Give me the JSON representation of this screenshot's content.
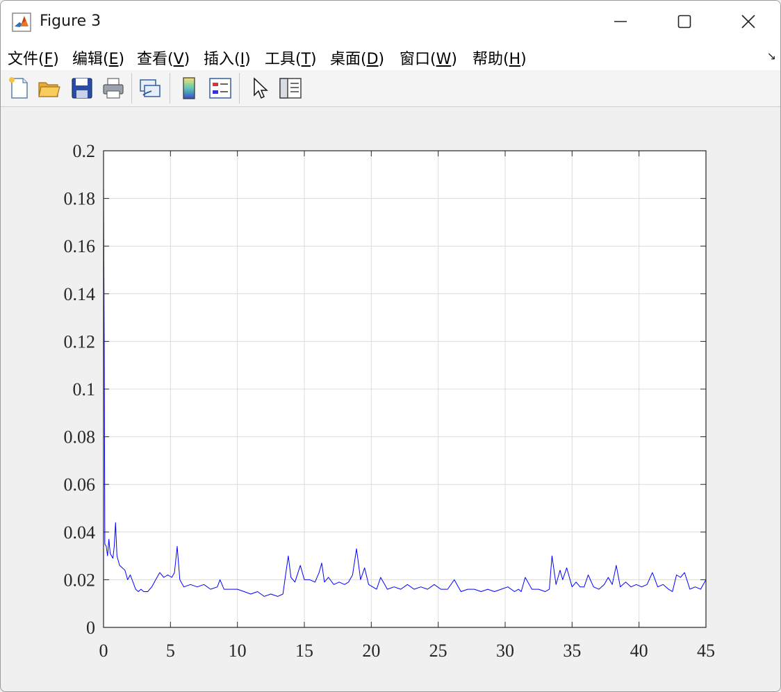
{
  "window": {
    "title": "Figure 3"
  },
  "menu": {
    "items": [
      {
        "pre": "文件(",
        "key": "F",
        "post": ")"
      },
      {
        "pre": "编辑(",
        "key": "E",
        "post": ")"
      },
      {
        "pre": "查看(",
        "key": "V",
        "post": ")"
      },
      {
        "pre": "插入(",
        "key": "I",
        "post": ")"
      },
      {
        "pre": "工具(",
        "key": "T",
        "post": ")"
      },
      {
        "pre": "桌面(",
        "key": "D",
        "post": ")"
      },
      {
        "pre": "窗口(",
        "key": "W",
        "post": ")"
      },
      {
        "pre": "帮助(",
        "key": "H",
        "post": ")"
      }
    ],
    "dock_glyph": "↘"
  },
  "toolbar": {
    "buttons": [
      "new-figure",
      "open-file",
      "save",
      "print",
      "link-plot",
      "insert-colorbar",
      "insert-legend",
      "edit-plot",
      "property-inspector"
    ]
  },
  "chart_data": {
    "type": "line",
    "title": "",
    "xlabel": "",
    "ylabel": "",
    "xlim": [
      0,
      45
    ],
    "ylim": [
      0,
      0.2
    ],
    "xticks": [
      0,
      5,
      10,
      15,
      20,
      25,
      30,
      35,
      40,
      45
    ],
    "yticks": [
      0,
      0.02,
      0.04,
      0.06,
      0.08,
      0.1,
      0.12,
      0.14,
      0.16,
      0.18,
      0.2
    ],
    "xtick_labels": [
      "0",
      "5",
      "10",
      "15",
      "20",
      "25",
      "30",
      "35",
      "40",
      "45"
    ],
    "ytick_labels": [
      "0",
      "0.02",
      "0.04",
      "0.06",
      "0.08",
      "0.1",
      "0.12",
      "0.14",
      "0.16",
      "0.18",
      "0.2"
    ],
    "grid": true,
    "line_color": "#0000ff",
    "series": [
      {
        "x": [
          0,
          0.05,
          0.1,
          0.2,
          0.3,
          0.4,
          0.5,
          0.6,
          0.7,
          0.8,
          0.9,
          1.0,
          1.1,
          1.2,
          1.4,
          1.6,
          1.8,
          2.0,
          2.2,
          2.4,
          2.6,
          2.8,
          3.0,
          3.3,
          3.6,
          3.9,
          4.2,
          4.5,
          4.8,
          5.1,
          5.3,
          5.5,
          5.7,
          6.0,
          6.5,
          7.0,
          7.5,
          8.0,
          8.5,
          8.7,
          9.0,
          9.5,
          10.0,
          10.5,
          11.0,
          11.5,
          12.0,
          12.5,
          13.0,
          13.4,
          13.6,
          13.8,
          14.0,
          14.3,
          14.7,
          15.0,
          15.4,
          15.8,
          16.1,
          16.3,
          16.5,
          16.8,
          17.2,
          17.6,
          18.0,
          18.3,
          18.6,
          18.9,
          19.2,
          19.5,
          19.8,
          20.1,
          20.4,
          20.7,
          21.2,
          21.7,
          22.2,
          22.7,
          23.2,
          23.7,
          24.2,
          24.7,
          25.2,
          25.7,
          26.2,
          26.7,
          27.2,
          27.7,
          28.2,
          28.7,
          29.2,
          29.7,
          30.2,
          30.7,
          31.0,
          31.2,
          31.5,
          32.0,
          32.5,
          33.0,
          33.3,
          33.5,
          33.8,
          34.1,
          34.3,
          34.6,
          35.0,
          35.3,
          35.6,
          35.9,
          36.2,
          36.6,
          37.0,
          37.4,
          37.7,
          38.0,
          38.3,
          38.6,
          39.0,
          39.4,
          39.8,
          40.2,
          40.6,
          41.0,
          41.4,
          41.8,
          42.2,
          42.5,
          42.8,
          43.1,
          43.4,
          43.8,
          44.2,
          44.6,
          45.0
        ],
        "y": [
          0.187,
          0.12,
          0.035,
          0.034,
          0.03,
          0.037,
          0.031,
          0.03,
          0.029,
          0.034,
          0.044,
          0.03,
          0.028,
          0.026,
          0.025,
          0.024,
          0.02,
          0.022,
          0.019,
          0.016,
          0.015,
          0.016,
          0.015,
          0.015,
          0.017,
          0.02,
          0.023,
          0.021,
          0.022,
          0.021,
          0.023,
          0.034,
          0.02,
          0.017,
          0.018,
          0.017,
          0.018,
          0.016,
          0.017,
          0.02,
          0.016,
          0.016,
          0.016,
          0.015,
          0.014,
          0.015,
          0.013,
          0.014,
          0.013,
          0.014,
          0.022,
          0.03,
          0.021,
          0.019,
          0.026,
          0.02,
          0.02,
          0.019,
          0.023,
          0.027,
          0.019,
          0.021,
          0.018,
          0.019,
          0.018,
          0.019,
          0.022,
          0.033,
          0.02,
          0.025,
          0.018,
          0.017,
          0.016,
          0.021,
          0.016,
          0.017,
          0.016,
          0.018,
          0.016,
          0.017,
          0.016,
          0.018,
          0.016,
          0.016,
          0.02,
          0.015,
          0.016,
          0.016,
          0.015,
          0.016,
          0.015,
          0.016,
          0.017,
          0.015,
          0.016,
          0.015,
          0.021,
          0.016,
          0.016,
          0.015,
          0.016,
          0.03,
          0.018,
          0.024,
          0.02,
          0.025,
          0.017,
          0.019,
          0.017,
          0.017,
          0.022,
          0.017,
          0.016,
          0.018,
          0.021,
          0.018,
          0.026,
          0.017,
          0.019,
          0.017,
          0.018,
          0.017,
          0.018,
          0.023,
          0.017,
          0.018,
          0.016,
          0.015,
          0.022,
          0.021,
          0.023,
          0.016,
          0.017,
          0.016,
          0.02
        ]
      }
    ]
  }
}
